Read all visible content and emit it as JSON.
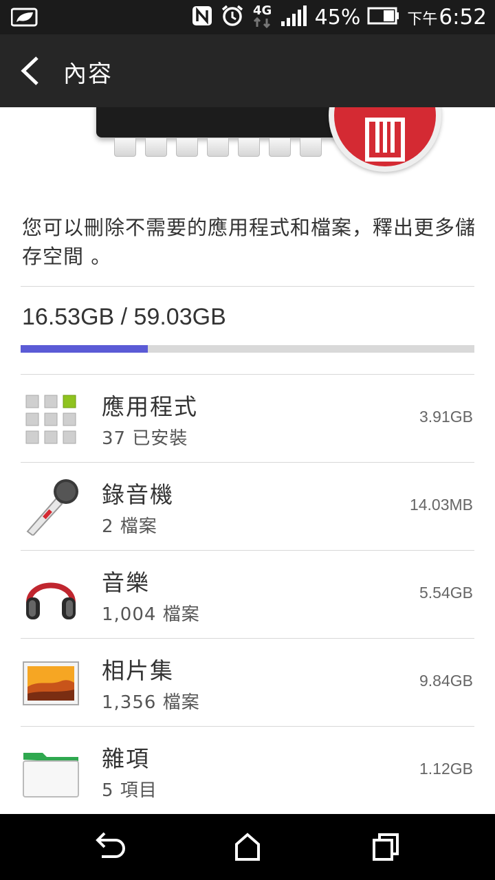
{
  "status_bar": {
    "battery_percent": "45%",
    "time_prefix": "下午",
    "time": "6:52",
    "network_type": "4G",
    "icons": [
      "leaf-icon",
      "nfc-icon",
      "alarm-icon",
      "4g-icon",
      "signal-icon",
      "battery-icon"
    ]
  },
  "action_bar": {
    "title": "內容"
  },
  "description": "您可以刪除不需要的應用程式和檔案，釋出更多儲存空間 。",
  "storage": {
    "usage_text": "16.53GB / 59.03GB",
    "used_fraction": 0.28,
    "accent": "#5b5bd6"
  },
  "categories": [
    {
      "title": "應用程式",
      "subtitle": "37 已安裝",
      "size": "3.91GB",
      "icon": "apps-grid-icon"
    },
    {
      "title": "錄音機",
      "subtitle": "2 檔案",
      "size": "14.03MB",
      "icon": "microphone-icon"
    },
    {
      "title": "音樂",
      "subtitle": "1,004 檔案",
      "size": "5.54GB",
      "icon": "headphones-icon"
    },
    {
      "title": "相片集",
      "subtitle": "1,356 檔案",
      "size": "9.84GB",
      "icon": "photo-icon"
    },
    {
      "title": "雜項",
      "subtitle": "5 項目",
      "size": "1.12GB",
      "icon": "folder-icon"
    }
  ],
  "nav_bar": {
    "icons": [
      "back-arrow-icon",
      "home-icon",
      "recents-icon"
    ]
  }
}
